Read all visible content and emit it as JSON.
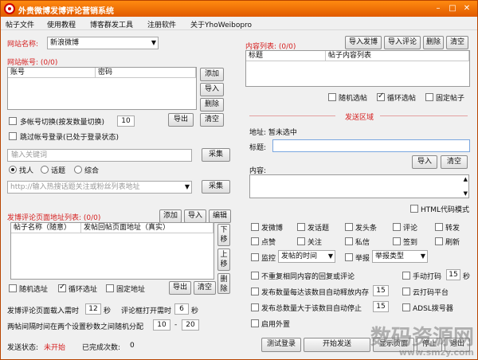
{
  "window": {
    "title": "外贵微博发博评论营销系统",
    "minimize": "–",
    "maximize": "□",
    "close": "✕"
  },
  "menu": [
    "帖子文件",
    "使用教程",
    "博客群发工具",
    "注册软件",
    "关于YhoWeibopro"
  ],
  "site": {
    "name_label": "网站名称:",
    "name_value": "新浪微博",
    "accounts_label": "网站帐号: (0/0)",
    "col_account": "账号",
    "col_password": "密码",
    "add": "添加",
    "import": "导入",
    "delete": "删除",
    "export": "导出",
    "clear": "清空",
    "multi_switch_label": "多帐号切换(按发数量切换)",
    "multi_switch_value": "10",
    "skip_login_label": "跳过帐号登录(已处于登录状态)"
  },
  "collect": {
    "keyword_placeholder": "输入关键词",
    "collect_btn": "采集",
    "radio_people": "找人",
    "radio_topic": "话题",
    "radio_all": "综合",
    "url_placeholder": "http://输入热搜话题关注或粉丝列表地址",
    "collect_btn2": "采集"
  },
  "posts": {
    "label": "发博评论页面地址列表: (0/0)",
    "add": "添加",
    "import": "导入",
    "edit": "编辑",
    "col_name": "帖子名称（随意）",
    "col_url": "发帖回帖页面地址（真实）",
    "move_down": "下移",
    "move_up": "上移",
    "delete": "删除",
    "random_label": "随机选址",
    "loop_label": "循环选址",
    "fixed_label": "固定地址",
    "export": "导出",
    "clear": "清空"
  },
  "timing": {
    "load_prefix": "发博评论页面载入需时",
    "load_value": "12",
    "load_unit": "秒",
    "open_prefix": "评论框打开需时",
    "open_value": "6",
    "open_unit": "秒",
    "interval_label": "两帖间隔时间在两个设置秒数之间随机分配",
    "interval_min": "10",
    "interval_dash": "-",
    "interval_max": "20"
  },
  "status": {
    "send_label": "发送状态:",
    "send_value": "未开始",
    "done_label": "已完成次数:",
    "done_value": "0"
  },
  "content": {
    "label": "内容列表: (0/0)",
    "import_post": "导入发博",
    "import_comment": "导入评论",
    "delete": "删除",
    "clear": "清空",
    "col_title": "标题",
    "col_content": "帖子内容列表",
    "random_label": "随机选帖",
    "loop_label": "循环选帖",
    "fixed_label": "固定帖子"
  },
  "send_area": {
    "section_label": "发送区域",
    "addr_label": "地址: 暂未选中",
    "title_label": "标题:",
    "import": "导入",
    "clear": "清空",
    "content_label": "内容:",
    "html_mode_label": "HTML代码模式"
  },
  "actions": {
    "row1": [
      "发微博",
      "发话题",
      "发头条",
      "评论",
      "转发"
    ],
    "row2": [
      "点赞",
      "关注",
      "私信",
      "签到",
      "刷新"
    ],
    "monitor_label": "监控",
    "monitor_select": "发帖的时间",
    "report_label": "举报",
    "report_select": "举报类型"
  },
  "options": {
    "no_repeat": "不重复相同内容的回复或评论",
    "manual_code": "手动打码",
    "manual_code_value": "15",
    "manual_code_unit": "秒",
    "auto_release_each": "发布数量每达该数目自动释放内存",
    "auto_release_value": "15",
    "cloud_code": "云打码平台",
    "auto_stop": "发布总数量大于该数目自动停止",
    "auto_stop_value": "15",
    "adsl": "ADSL拨号器",
    "external": "启用外置"
  },
  "bottom_buttons": [
    "测试登录",
    "开始发送",
    "显示页面",
    "停止",
    "退出"
  ],
  "watermark": {
    "text": "数码资源网",
    "sub": "www.smzy.com"
  },
  "colors": {
    "title_bar": "#e05a00",
    "accent_red": "#d62020"
  }
}
